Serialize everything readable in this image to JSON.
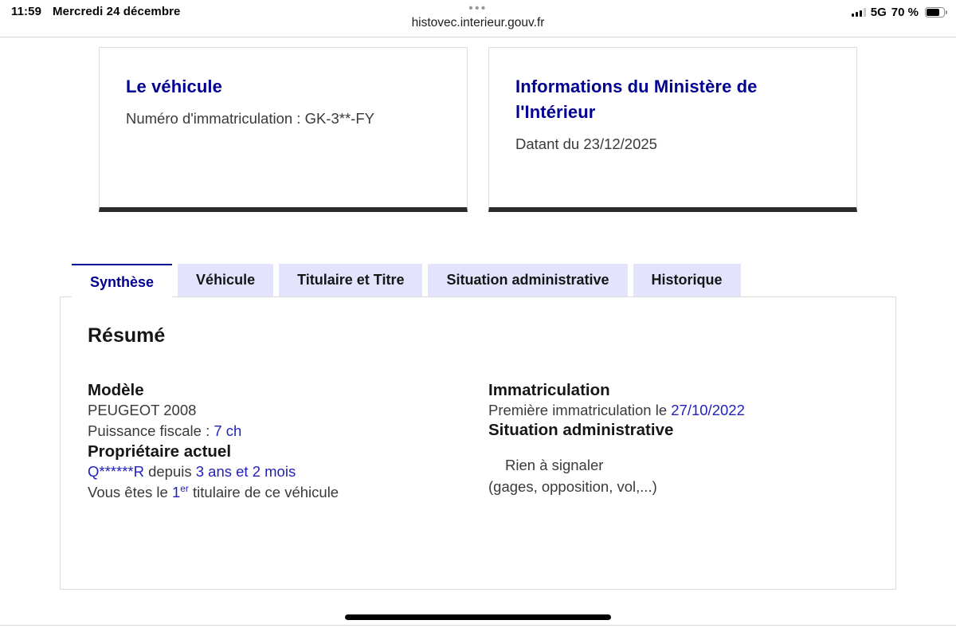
{
  "status_bar": {
    "time": "11:59",
    "date": "Mercredi 24 décembre",
    "tab_dots": "•••",
    "url": "histovec.interieur.gouv.fr",
    "network": "5G",
    "battery": "70 %"
  },
  "cards": {
    "vehicle": {
      "title": "Le véhicule",
      "line": "Numéro d'immatriculation : GK-3**-FY"
    },
    "ministry": {
      "title": "Informations du Ministère de l'Intérieur",
      "line": "Datant du 23/12/2025"
    }
  },
  "tabs": [
    {
      "label": "Synthèse",
      "active": true
    },
    {
      "label": "Véhicule",
      "active": false
    },
    {
      "label": "Titulaire et Titre",
      "active": false
    },
    {
      "label": "Situation administrative",
      "active": false
    },
    {
      "label": "Historique",
      "active": false
    }
  ],
  "panel": {
    "title": "Résumé",
    "model": {
      "heading": "Modèle",
      "name": "PEUGEOT 2008",
      "fiscal_label": "Puissance fiscale : ",
      "fiscal_value": "7 ch"
    },
    "owner": {
      "heading": "Propriétaire actuel",
      "code": "Q******R",
      "since_label": " depuis ",
      "since_value": "3 ans et 2 mois",
      "holder_prefix": "Vous êtes le ",
      "holder_number": "1",
      "holder_sup": "er",
      "holder_suffix": " titulaire de ce véhicule"
    },
    "registration": {
      "heading": "Immatriculation",
      "label": "Première immatriculation le ",
      "value": "27/10/2022"
    },
    "situation": {
      "heading": "Situation administrative",
      "status": "Rien à signaler",
      "note": "(gages, opposition, vol,...)"
    }
  },
  "colors": {
    "heading_blue": "#000091",
    "value_blue": "#2222bb",
    "tab_inactive_bg": "#e3e3fd",
    "body_gray": "#3a3a3a",
    "card_bottom_bar": "#2b2b2b"
  }
}
